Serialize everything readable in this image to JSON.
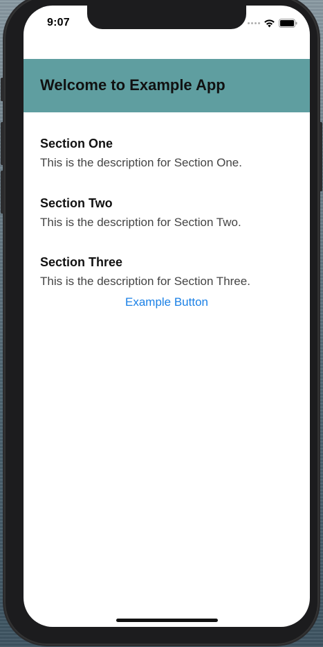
{
  "status_bar": {
    "time": "9:07",
    "icons": [
      "signal-dots-icon",
      "wifi-icon",
      "battery-icon"
    ]
  },
  "header": {
    "title": "Welcome to Example App",
    "background_color": "#5f9ea0"
  },
  "sections": [
    {
      "title": "Section One",
      "description": "This is the description for Section One."
    },
    {
      "title": "Section Two",
      "description": "This is the description for Section Two."
    },
    {
      "title": "Section Three",
      "description": "This is the description for Section Three."
    }
  ],
  "button": {
    "label": "Example Button",
    "color": "#1a80e6"
  }
}
